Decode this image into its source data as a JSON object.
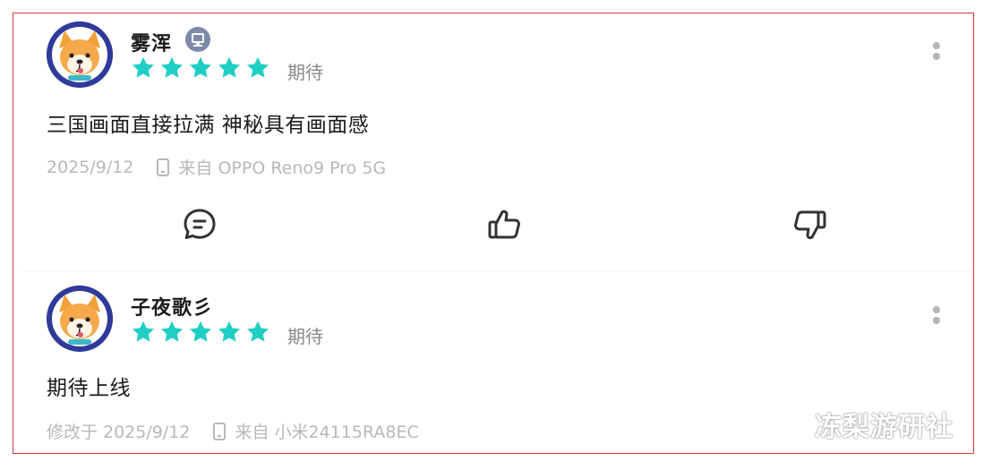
{
  "reviews": [
    {
      "username": "雾浑",
      "rating_stars": 5,
      "rating_label": "期待",
      "content": "三国画面直接拉满 神秘具有画面感",
      "date": "2025/9/12",
      "device": "来自 OPPO Reno9 Pro 5G",
      "icons": [
        "device-badge-icon",
        "star-icon",
        "more-icon",
        "phone-icon",
        "comment-icon",
        "thumbs-up-icon",
        "thumbs-down-icon"
      ]
    },
    {
      "username": "子夜歌彡",
      "rating_stars": 5,
      "rating_label": "期待",
      "content": "期待上线",
      "date": "修改于 2025/9/12",
      "device": "来自 小米24115RA8EC",
      "icons": [
        "star-icon",
        "more-icon",
        "phone-icon"
      ]
    }
  ],
  "watermark": "冻梨游研社",
  "colors": {
    "star": "#1fcfc4",
    "border": "#d23a3a",
    "meta_text": "#b8b8b8",
    "icon_stroke": "#333333"
  }
}
